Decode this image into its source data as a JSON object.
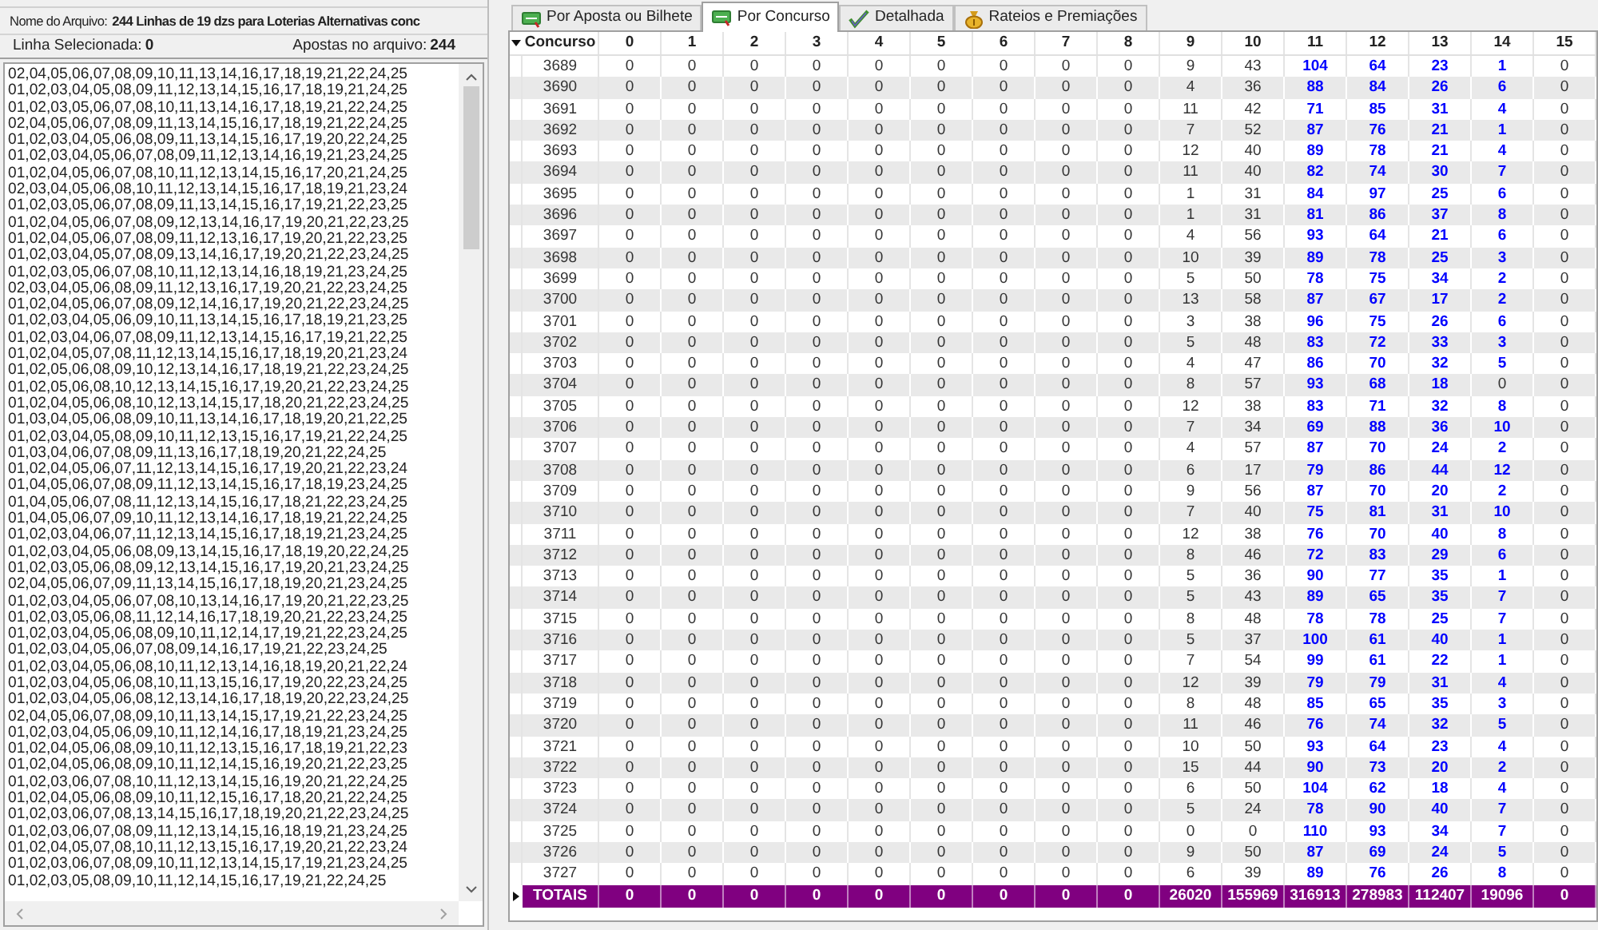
{
  "file_bar": {
    "label": "Nome do Arquivo:",
    "value": "244 Linhas de 19 dzs para Loterias Alternativas conc"
  },
  "selection_bar": {
    "selected_label": "Linha Selecionada:",
    "selected_value": "0",
    "count_label": "Apostas no arquivo:",
    "count_value": "244"
  },
  "lines": [
    "02,04,05,06,07,08,09,10,11,13,14,16,17,18,19,21,22,24,25",
    "01,02,03,04,05,08,09,11,12,13,14,15,16,17,18,19,21,24,25",
    "01,02,03,05,06,07,08,10,11,13,14,16,17,18,19,21,22,24,25",
    "02,04,05,06,07,08,09,11,13,14,15,16,17,18,19,21,22,24,25",
    "01,02,03,04,05,06,08,09,11,13,14,15,16,17,19,20,22,24,25",
    "01,02,03,04,05,06,07,08,09,11,12,13,14,16,19,21,23,24,25",
    "01,02,04,05,06,07,08,10,11,12,13,14,15,16,17,20,21,24,25",
    "02,03,04,05,06,08,10,11,12,13,14,15,16,17,18,19,21,23,24",
    "01,02,03,05,06,07,08,09,11,13,14,15,16,17,19,21,22,23,25",
    "01,02,04,05,06,07,08,09,12,13,14,16,17,19,20,21,22,23,25",
    "01,02,04,05,06,07,08,09,11,12,13,16,17,19,20,21,22,23,25",
    "01,02,03,04,05,07,08,09,13,14,16,17,19,20,21,22,23,24,25",
    "01,02,03,05,06,07,08,10,11,12,13,14,16,18,19,21,23,24,25",
    "02,03,04,05,06,08,09,11,12,13,16,17,19,20,21,22,23,24,25",
    "01,02,04,05,06,07,08,09,12,14,16,17,19,20,21,22,23,24,25",
    "01,02,03,04,05,06,09,10,11,13,14,15,16,17,18,19,21,23,25",
    "01,02,03,04,06,07,08,09,11,12,13,14,15,16,17,19,21,22,25",
    "01,02,04,05,07,08,11,12,13,14,15,16,17,18,19,20,21,23,24",
    "01,02,05,06,08,09,10,12,13,14,16,17,18,19,21,22,23,24,25",
    "01,02,05,06,08,10,12,13,14,15,16,17,19,20,21,22,23,24,25",
    "01,02,04,05,06,08,10,12,13,14,15,17,18,20,21,22,23,24,25",
    "01,03,04,05,06,08,09,10,11,13,14,16,17,18,19,20,21,22,25",
    "01,02,03,04,05,08,09,10,11,12,13,15,16,17,19,21,22,24,25",
    "01,03,04,06,07,08,09,11,13,16,17,18,19,20,21,22,24,25",
    "01,02,04,05,06,07,11,12,13,14,15,16,17,19,20,21,22,23,24",
    "01,04,05,06,07,08,09,11,12,13,14,15,16,17,18,19,23,24,25",
    "01,04,05,06,07,08,11,12,13,14,15,16,17,18,21,22,23,24,25",
    "01,04,05,06,07,09,10,11,12,13,14,16,17,18,19,21,22,24,25",
    "01,02,03,04,06,07,11,12,13,14,15,16,17,18,19,21,23,24,25",
    "01,02,03,04,05,06,08,09,13,14,15,16,17,18,19,20,22,24,25",
    "01,02,03,05,06,08,09,12,13,14,15,16,17,19,20,21,23,24,25",
    "02,04,05,06,07,09,11,13,14,15,16,17,18,19,20,21,23,24,25",
    "01,02,03,04,05,06,07,08,10,13,14,16,17,19,20,21,22,23,25",
    "01,02,03,05,06,08,11,12,14,16,17,18,19,20,21,22,23,24,25",
    "01,02,03,04,05,06,08,09,10,11,12,14,17,19,21,22,23,24,25",
    "01,02,03,04,05,06,07,08,09,14,16,17,19,21,22,23,24,25",
    "01,02,03,04,05,06,08,10,11,12,13,14,16,18,19,20,21,22,24",
    "01,02,03,04,05,06,08,10,11,13,15,16,17,19,20,22,23,24,25",
    "01,02,03,04,05,06,08,12,13,14,16,17,18,19,20,22,23,24,25",
    "02,04,05,06,07,08,09,10,11,13,14,15,17,19,21,22,23,24,25",
    "01,02,03,04,05,06,09,10,11,12,14,16,17,18,19,21,23,24,25",
    "01,02,04,05,06,08,09,10,11,12,13,15,16,17,18,19,21,22,23",
    "01,02,04,05,06,08,09,10,11,12,14,15,16,19,20,21,22,23,25",
    "01,02,03,06,07,08,10,11,12,13,14,15,16,19,20,21,22,24,25",
    "01,02,04,05,06,08,09,10,11,12,15,16,17,18,20,21,22,24,25",
    "01,02,03,06,07,08,13,14,15,16,17,18,19,20,21,22,23,24,25",
    "01,02,03,06,07,08,09,11,12,13,14,15,16,18,19,21,23,24,25",
    "01,02,04,05,07,08,10,11,12,13,15,16,17,19,20,21,22,23,24",
    "01,02,03,06,07,08,09,10,11,12,13,14,15,17,19,21,23,24,25",
    "01,02,03,05,08,09,10,11,12,14,15,16,17,19,21,22,24,25"
  ],
  "tabs": [
    {
      "label": "Por Aposta ou Bilhete",
      "selected": false,
      "kind": "ticket"
    },
    {
      "label": "Por Concurso",
      "selected": true,
      "kind": "ticket"
    },
    {
      "label": "Detalhada",
      "selected": false,
      "kind": "check"
    },
    {
      "label": "Rateios e Premiações",
      "selected": false,
      "kind": "bag"
    }
  ],
  "table": {
    "columns": [
      "Concurso",
      "0",
      "1",
      "2",
      "3",
      "4",
      "5",
      "6",
      "7",
      "8",
      "9",
      "10",
      "11",
      "12",
      "13",
      "14",
      "15"
    ],
    "rows": [
      {
        "cells": [
          "3689",
          "0",
          "0",
          "0",
          "0",
          "0",
          "0",
          "0",
          "0",
          "0",
          "9",
          "43",
          {
            "text": "104",
            "highlighted": true
          },
          {
            "text": "64",
            "highlighted": true
          },
          {
            "text": "23",
            "highlighted": true
          },
          {
            "text": "1",
            "highlighted": true
          },
          "0"
        ]
      },
      {
        "cells": [
          "3690",
          "0",
          "0",
          "0",
          "0",
          "0",
          "0",
          "0",
          "0",
          "0",
          "4",
          "36",
          {
            "text": "88",
            "highlighted": true
          },
          {
            "text": "84",
            "highlighted": true
          },
          {
            "text": "26",
            "highlighted": true
          },
          {
            "text": "6",
            "highlighted": true
          },
          "0"
        ]
      },
      {
        "cells": [
          "3691",
          "0",
          "0",
          "0",
          "0",
          "0",
          "0",
          "0",
          "0",
          "0",
          "11",
          "42",
          {
            "text": "71",
            "highlighted": true
          },
          {
            "text": "85",
            "highlighted": true
          },
          {
            "text": "31",
            "highlighted": true
          },
          {
            "text": "4",
            "highlighted": true
          },
          "0"
        ]
      },
      {
        "cells": [
          "3692",
          "0",
          "0",
          "0",
          "0",
          "0",
          "0",
          "0",
          "0",
          "0",
          "7",
          "52",
          {
            "text": "87",
            "highlighted": true
          },
          {
            "text": "76",
            "highlighted": true
          },
          {
            "text": "21",
            "highlighted": true
          },
          {
            "text": "1",
            "highlighted": true
          },
          "0"
        ]
      },
      {
        "cells": [
          "3693",
          "0",
          "0",
          "0",
          "0",
          "0",
          "0",
          "0",
          "0",
          "0",
          "12",
          "40",
          {
            "text": "89",
            "highlighted": true
          },
          {
            "text": "78",
            "highlighted": true
          },
          {
            "text": "21",
            "highlighted": true
          },
          {
            "text": "4",
            "highlighted": true
          },
          "0"
        ]
      },
      {
        "cells": [
          "3694",
          "0",
          "0",
          "0",
          "0",
          "0",
          "0",
          "0",
          "0",
          "0",
          "11",
          "40",
          {
            "text": "82",
            "highlighted": true
          },
          {
            "text": "74",
            "highlighted": true
          },
          {
            "text": "30",
            "highlighted": true
          },
          {
            "text": "7",
            "highlighted": true
          },
          "0"
        ]
      },
      {
        "cells": [
          "3695",
          "0",
          "0",
          "0",
          "0",
          "0",
          "0",
          "0",
          "0",
          "0",
          "1",
          "31",
          {
            "text": "84",
            "highlighted": true
          },
          {
            "text": "97",
            "highlighted": true
          },
          {
            "text": "25",
            "highlighted": true
          },
          {
            "text": "6",
            "highlighted": true
          },
          "0"
        ]
      },
      {
        "cells": [
          "3696",
          "0",
          "0",
          "0",
          "0",
          "0",
          "0",
          "0",
          "0",
          "0",
          "1",
          "31",
          {
            "text": "81",
            "highlighted": true
          },
          {
            "text": "86",
            "highlighted": true
          },
          {
            "text": "37",
            "highlighted": true
          },
          {
            "text": "8",
            "highlighted": true
          },
          "0"
        ]
      },
      {
        "cells": [
          "3697",
          "0",
          "0",
          "0",
          "0",
          "0",
          "0",
          "0",
          "0",
          "0",
          "4",
          "56",
          {
            "text": "93",
            "highlighted": true
          },
          {
            "text": "64",
            "highlighted": true
          },
          {
            "text": "21",
            "highlighted": true
          },
          {
            "text": "6",
            "highlighted": true
          },
          "0"
        ]
      },
      {
        "cells": [
          "3698",
          "0",
          "0",
          "0",
          "0",
          "0",
          "0",
          "0",
          "0",
          "0",
          "10",
          "39",
          {
            "text": "89",
            "highlighted": true
          },
          {
            "text": "78",
            "highlighted": true
          },
          {
            "text": "25",
            "highlighted": true
          },
          {
            "text": "3",
            "highlighted": true
          },
          "0"
        ]
      },
      {
        "cells": [
          "3699",
          "0",
          "0",
          "0",
          "0",
          "0",
          "0",
          "0",
          "0",
          "0",
          "5",
          "50",
          {
            "text": "78",
            "highlighted": true
          },
          {
            "text": "75",
            "highlighted": true
          },
          {
            "text": "34",
            "highlighted": true
          },
          {
            "text": "2",
            "highlighted": true
          },
          "0"
        ]
      },
      {
        "cells": [
          "3700",
          "0",
          "0",
          "0",
          "0",
          "0",
          "0",
          "0",
          "0",
          "0",
          "13",
          "58",
          {
            "text": "87",
            "highlighted": true
          },
          {
            "text": "67",
            "highlighted": true
          },
          {
            "text": "17",
            "highlighted": true
          },
          {
            "text": "2",
            "highlighted": true
          },
          "0"
        ]
      },
      {
        "cells": [
          "3701",
          "0",
          "0",
          "0",
          "0",
          "0",
          "0",
          "0",
          "0",
          "0",
          "3",
          "38",
          {
            "text": "96",
            "highlighted": true
          },
          {
            "text": "75",
            "highlighted": true
          },
          {
            "text": "26",
            "highlighted": true
          },
          {
            "text": "6",
            "highlighted": true
          },
          "0"
        ]
      },
      {
        "cells": [
          "3702",
          "0",
          "0",
          "0",
          "0",
          "0",
          "0",
          "0",
          "0",
          "0",
          "5",
          "48",
          {
            "text": "83",
            "highlighted": true
          },
          {
            "text": "72",
            "highlighted": true
          },
          {
            "text": "33",
            "highlighted": true
          },
          {
            "text": "3",
            "highlighted": true
          },
          "0"
        ]
      },
      {
        "cells": [
          "3703",
          "0",
          "0",
          "0",
          "0",
          "0",
          "0",
          "0",
          "0",
          "0",
          "4",
          "47",
          {
            "text": "86",
            "highlighted": true
          },
          {
            "text": "70",
            "highlighted": true
          },
          {
            "text": "32",
            "highlighted": true
          },
          {
            "text": "5",
            "highlighted": true
          },
          "0"
        ]
      },
      {
        "cells": [
          "3704",
          "0",
          "0",
          "0",
          "0",
          "0",
          "0",
          "0",
          "0",
          "0",
          "8",
          "57",
          {
            "text": "93",
            "highlighted": true
          },
          {
            "text": "68",
            "highlighted": true
          },
          {
            "text": "18",
            "highlighted": true
          },
          {
            "text": "0",
            "highlighted": false
          },
          "0"
        ]
      },
      {
        "cells": [
          "3705",
          "0",
          "0",
          "0",
          "0",
          "0",
          "0",
          "0",
          "0",
          "0",
          "12",
          "38",
          {
            "text": "83",
            "highlighted": true
          },
          {
            "text": "71",
            "highlighted": true
          },
          {
            "text": "32",
            "highlighted": true
          },
          {
            "text": "8",
            "highlighted": true
          },
          "0"
        ]
      },
      {
        "cells": [
          "3706",
          "0",
          "0",
          "0",
          "0",
          "0",
          "0",
          "0",
          "0",
          "0",
          "7",
          "34",
          {
            "text": "69",
            "highlighted": true
          },
          {
            "text": "88",
            "highlighted": true
          },
          {
            "text": "36",
            "highlighted": true
          },
          {
            "text": "10",
            "highlighted": true
          },
          "0"
        ]
      },
      {
        "cells": [
          "3707",
          "0",
          "0",
          "0",
          "0",
          "0",
          "0",
          "0",
          "0",
          "0",
          "4",
          "57",
          {
            "text": "87",
            "highlighted": true
          },
          {
            "text": "70",
            "highlighted": true
          },
          {
            "text": "24",
            "highlighted": true
          },
          {
            "text": "2",
            "highlighted": true
          },
          "0"
        ]
      },
      {
        "cells": [
          "3708",
          "0",
          "0",
          "0",
          "0",
          "0",
          "0",
          "0",
          "0",
          "0",
          "6",
          "17",
          {
            "text": "79",
            "highlighted": true
          },
          {
            "text": "86",
            "highlighted": true
          },
          {
            "text": "44",
            "highlighted": true
          },
          {
            "text": "12",
            "highlighted": true
          },
          "0"
        ]
      },
      {
        "cells": [
          "3709",
          "0",
          "0",
          "0",
          "0",
          "0",
          "0",
          "0",
          "0",
          "0",
          "9",
          "56",
          {
            "text": "87",
            "highlighted": true
          },
          {
            "text": "70",
            "highlighted": true
          },
          {
            "text": "20",
            "highlighted": true
          },
          {
            "text": "2",
            "highlighted": true
          },
          "0"
        ]
      },
      {
        "cells": [
          "3710",
          "0",
          "0",
          "0",
          "0",
          "0",
          "0",
          "0",
          "0",
          "0",
          "7",
          "40",
          {
            "text": "75",
            "highlighted": true
          },
          {
            "text": "81",
            "highlighted": true
          },
          {
            "text": "31",
            "highlighted": true
          },
          {
            "text": "10",
            "highlighted": true
          },
          "0"
        ]
      },
      {
        "cells": [
          "3711",
          "0",
          "0",
          "0",
          "0",
          "0",
          "0",
          "0",
          "0",
          "0",
          "12",
          "38",
          {
            "text": "76",
            "highlighted": true
          },
          {
            "text": "70",
            "highlighted": true
          },
          {
            "text": "40",
            "highlighted": true
          },
          {
            "text": "8",
            "highlighted": true
          },
          "0"
        ]
      },
      {
        "cells": [
          "3712",
          "0",
          "0",
          "0",
          "0",
          "0",
          "0",
          "0",
          "0",
          "0",
          "8",
          "46",
          {
            "text": "72",
            "highlighted": true
          },
          {
            "text": "83",
            "highlighted": true
          },
          {
            "text": "29",
            "highlighted": true
          },
          {
            "text": "6",
            "highlighted": true
          },
          "0"
        ]
      },
      {
        "cells": [
          "3713",
          "0",
          "0",
          "0",
          "0",
          "0",
          "0",
          "0",
          "0",
          "0",
          "5",
          "36",
          {
            "text": "90",
            "highlighted": true
          },
          {
            "text": "77",
            "highlighted": true
          },
          {
            "text": "35",
            "highlighted": true
          },
          {
            "text": "1",
            "highlighted": true
          },
          "0"
        ]
      },
      {
        "cells": [
          "3714",
          "0",
          "0",
          "0",
          "0",
          "0",
          "0",
          "0",
          "0",
          "0",
          "5",
          "43",
          {
            "text": "89",
            "highlighted": true
          },
          {
            "text": "65",
            "highlighted": true
          },
          {
            "text": "35",
            "highlighted": true
          },
          {
            "text": "7",
            "highlighted": true
          },
          "0"
        ]
      },
      {
        "cells": [
          "3715",
          "0",
          "0",
          "0",
          "0",
          "0",
          "0",
          "0",
          "0",
          "0",
          "8",
          "48",
          {
            "text": "78",
            "highlighted": true
          },
          {
            "text": "78",
            "highlighted": true
          },
          {
            "text": "25",
            "highlighted": true
          },
          {
            "text": "7",
            "highlighted": true
          },
          "0"
        ]
      },
      {
        "cells": [
          "3716",
          "0",
          "0",
          "0",
          "0",
          "0",
          "0",
          "0",
          "0",
          "0",
          "5",
          "37",
          {
            "text": "100",
            "highlighted": true
          },
          {
            "text": "61",
            "highlighted": true
          },
          {
            "text": "40",
            "highlighted": true
          },
          {
            "text": "1",
            "highlighted": true
          },
          "0"
        ]
      },
      {
        "cells": [
          "3717",
          "0",
          "0",
          "0",
          "0",
          "0",
          "0",
          "0",
          "0",
          "0",
          "7",
          "54",
          {
            "text": "99",
            "highlighted": true
          },
          {
            "text": "61",
            "highlighted": true
          },
          {
            "text": "22",
            "highlighted": true
          },
          {
            "text": "1",
            "highlighted": true
          },
          "0"
        ]
      },
      {
        "cells": [
          "3718",
          "0",
          "0",
          "0",
          "0",
          "0",
          "0",
          "0",
          "0",
          "0",
          "12",
          "39",
          {
            "text": "79",
            "highlighted": true
          },
          {
            "text": "79",
            "highlighted": true
          },
          {
            "text": "31",
            "highlighted": true
          },
          {
            "text": "4",
            "highlighted": true
          },
          "0"
        ]
      },
      {
        "cells": [
          "3719",
          "0",
          "0",
          "0",
          "0",
          "0",
          "0",
          "0",
          "0",
          "0",
          "8",
          "48",
          {
            "text": "85",
            "highlighted": true
          },
          {
            "text": "65",
            "highlighted": true
          },
          {
            "text": "35",
            "highlighted": true
          },
          {
            "text": "3",
            "highlighted": true
          },
          "0"
        ]
      },
      {
        "cells": [
          "3720",
          "0",
          "0",
          "0",
          "0",
          "0",
          "0",
          "0",
          "0",
          "0",
          "11",
          "46",
          {
            "text": "76",
            "highlighted": true
          },
          {
            "text": "74",
            "highlighted": true
          },
          {
            "text": "32",
            "highlighted": true
          },
          {
            "text": "5",
            "highlighted": true
          },
          "0"
        ]
      },
      {
        "cells": [
          "3721",
          "0",
          "0",
          "0",
          "0",
          "0",
          "0",
          "0",
          "0",
          "0",
          "10",
          "50",
          {
            "text": "93",
            "highlighted": true
          },
          {
            "text": "64",
            "highlighted": true
          },
          {
            "text": "23",
            "highlighted": true
          },
          {
            "text": "4",
            "highlighted": true
          },
          "0"
        ]
      },
      {
        "cells": [
          "3722",
          "0",
          "0",
          "0",
          "0",
          "0",
          "0",
          "0",
          "0",
          "0",
          "15",
          "44",
          {
            "text": "90",
            "highlighted": true
          },
          {
            "text": "73",
            "highlighted": true
          },
          {
            "text": "20",
            "highlighted": true
          },
          {
            "text": "2",
            "highlighted": true
          },
          "0"
        ]
      },
      {
        "cells": [
          "3723",
          "0",
          "0",
          "0",
          "0",
          "0",
          "0",
          "0",
          "0",
          "0",
          "6",
          "50",
          {
            "text": "104",
            "highlighted": true
          },
          {
            "text": "62",
            "highlighted": true
          },
          {
            "text": "18",
            "highlighted": true
          },
          {
            "text": "4",
            "highlighted": true
          },
          "0"
        ]
      },
      {
        "cells": [
          "3724",
          "0",
          "0",
          "0",
          "0",
          "0",
          "0",
          "0",
          "0",
          "0",
          "5",
          "24",
          {
            "text": "78",
            "highlighted": true
          },
          {
            "text": "90",
            "highlighted": true
          },
          {
            "text": "40",
            "highlighted": true
          },
          {
            "text": "7",
            "highlighted": true
          },
          "0"
        ]
      },
      {
        "cells": [
          "3725",
          "0",
          "0",
          "0",
          "0",
          "0",
          "0",
          "0",
          "0",
          "0",
          "0",
          "0",
          {
            "text": "110",
            "highlighted": true
          },
          {
            "text": "93",
            "highlighted": true
          },
          {
            "text": "34",
            "highlighted": true
          },
          {
            "text": "7",
            "highlighted": true
          },
          "0"
        ]
      },
      {
        "cells": [
          "3726",
          "0",
          "0",
          "0",
          "0",
          "0",
          "0",
          "0",
          "0",
          "0",
          "9",
          "50",
          {
            "text": "87",
            "highlighted": true
          },
          {
            "text": "69",
            "highlighted": true
          },
          {
            "text": "24",
            "highlighted": true
          },
          {
            "text": "5",
            "highlighted": true
          },
          "0"
        ]
      },
      {
        "cells": [
          "3727",
          "0",
          "0",
          "0",
          "0",
          "0",
          "0",
          "0",
          "0",
          "0",
          "6",
          "39",
          {
            "text": "89",
            "highlighted": true
          },
          {
            "text": "76",
            "highlighted": true
          },
          {
            "text": "26",
            "highlighted": true
          },
          {
            "text": "8",
            "highlighted": true
          },
          "0"
        ]
      }
    ],
    "totals": {
      "cells": [
        "TOTAIS",
        "0",
        "0",
        "0",
        "0",
        "0",
        "0",
        "0",
        "0",
        "0",
        "26020",
        "155969",
        "316913",
        "278983",
        "112407",
        "19096",
        "0"
      ]
    }
  }
}
